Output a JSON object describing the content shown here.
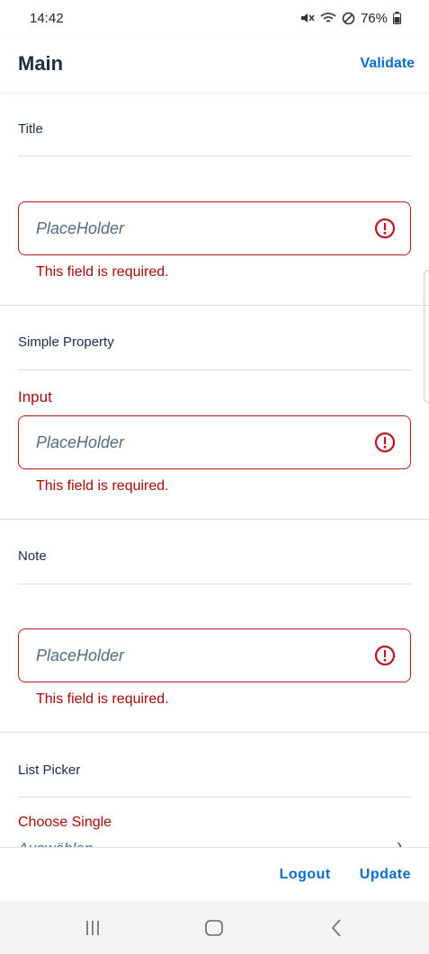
{
  "status_bar": {
    "time": "14:42",
    "battery": "76%"
  },
  "header": {
    "title": "Main",
    "validate_label": "Validate"
  },
  "sections": [
    {
      "title": "Title",
      "field_label": "",
      "placeholder": "PlaceHolder",
      "error": "This field is required."
    },
    {
      "title": "Simple Property",
      "field_label": "Input",
      "placeholder": "PlaceHolder",
      "error": "This field is required."
    },
    {
      "title": "Note",
      "field_label": "",
      "placeholder": "PlaceHolder",
      "error": "This field is required."
    }
  ],
  "list_picker": {
    "title": "List Picker",
    "label": "Choose Single",
    "value": "Auswählen",
    "chevron": "›"
  },
  "toolbar": {
    "logout_label": "Logout",
    "update_label": "Update"
  },
  "colors": {
    "accent": "#0a6ed1",
    "error": "#aa0808",
    "error_border": "#c3131f"
  },
  "icons": {
    "error": "error-icon",
    "nav_recents": "recents-icon",
    "nav_home": "home-icon",
    "nav_back": "back-icon"
  }
}
